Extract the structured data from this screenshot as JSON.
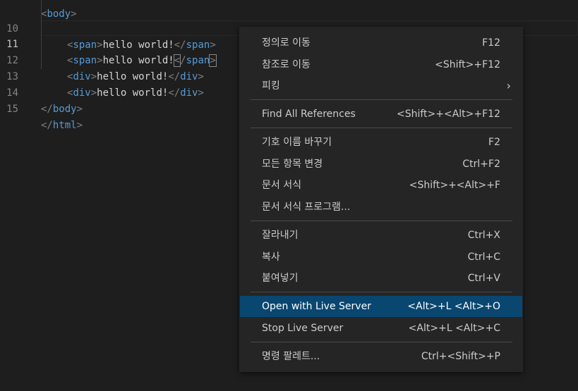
{
  "editor": {
    "lines": [
      {
        "num": "10",
        "indent": "    ",
        "open_tag": "span",
        "text": "hello world!",
        "close_tag": "span"
      },
      {
        "num": "11",
        "indent": "    ",
        "open_tag": "span",
        "text": "hello world!",
        "close_tag": "span"
      },
      {
        "num": "12",
        "indent": "    ",
        "open_tag": "div",
        "text": "hello world!",
        "close_tag": "div"
      },
      {
        "num": "13",
        "indent": "    ",
        "open_tag": "div",
        "text": "hello world!",
        "close_tag": "div"
      },
      {
        "num": "14",
        "indent": "",
        "close_tag": "body"
      },
      {
        "num": "15",
        "indent": "",
        "close_tag": "html"
      }
    ],
    "partial_top_line": "<body>"
  },
  "context_menu": {
    "items": [
      {
        "label": "정의로 이동",
        "shortcut": "F12"
      },
      {
        "label": "참조로 이동",
        "shortcut": "<Shift>+F12"
      },
      {
        "label": "피킹",
        "submenu": "›"
      },
      {
        "label": "Find All References",
        "shortcut": "<Shift>+<Alt>+F12"
      },
      {
        "label": "기호 이름 바꾸기",
        "shortcut": "F2"
      },
      {
        "label": "모든 항목 변경",
        "shortcut": "Ctrl+F2"
      },
      {
        "label": "문서 서식",
        "shortcut": "<Shift>+<Alt>+F"
      },
      {
        "label": "문서 서식 프로그램...",
        "shortcut": ""
      },
      {
        "label": "잘라내기",
        "shortcut": "Ctrl+X"
      },
      {
        "label": "복사",
        "shortcut": "Ctrl+C"
      },
      {
        "label": "붙여넣기",
        "shortcut": "Ctrl+V"
      },
      {
        "label": "Open with Live Server",
        "shortcut": "<Alt>+L <Alt>+O",
        "highlighted": true
      },
      {
        "label": "Stop Live Server",
        "shortcut": "<Alt>+L <Alt>+C"
      },
      {
        "label": "명령 팔레트...",
        "shortcut": "Ctrl+<Shift>+P"
      }
    ]
  },
  "colors": {
    "background": "#1e1e1e",
    "menu_background": "#252526",
    "highlight": "#094771",
    "tag": "#569cd6",
    "bracket": "#808080",
    "text": "#d4d4d4"
  }
}
